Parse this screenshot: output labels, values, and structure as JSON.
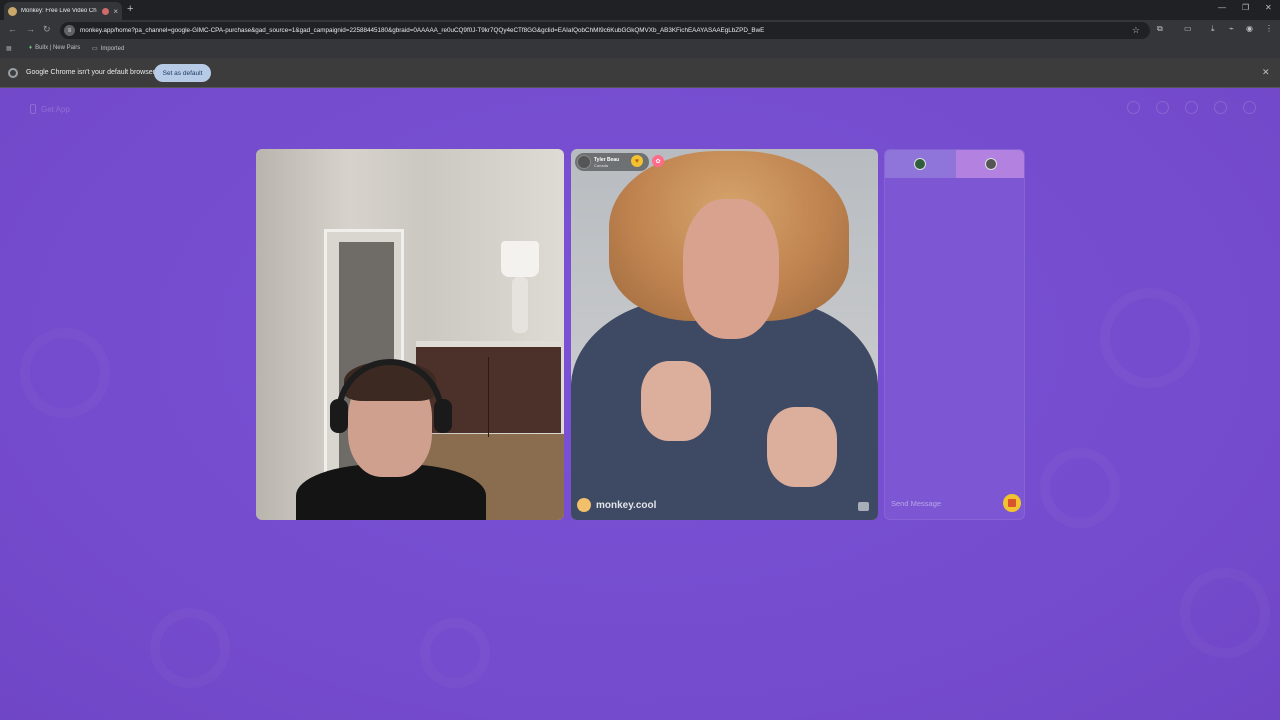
{
  "browser": {
    "tab_title": "Monkey: Free Live Video Ch",
    "url": "monkey.app/home?pa_channel=google-GIMC-CPA-purchase&gad_source=1&gad_campaignid=22588445180&gbraid=0AAAAA_re0uCQ9f0J-T9kr7QQy4eCTf8GG&gclid=EAIaIQobChMI9c6KubGGkQMVXb_AB3KFichEAAYASAAEgLbZPD_BwE",
    "bookmarks": [
      {
        "label": "Bullx | New Pairs",
        "icon": "bookmark-icon"
      },
      {
        "label": "Imported",
        "icon": "folder-icon"
      }
    ],
    "infobar": {
      "message": "Google Chrome isn't your default browser",
      "button": "Set as default"
    }
  },
  "app": {
    "get_app": "Get App",
    "top_icons": [
      "search-icon",
      "coin-icon",
      "history-icon",
      "chat-icon",
      "profile-icon"
    ],
    "remote_user": {
      "name": "Tyler Beau",
      "country": "Canada"
    },
    "watermark": "monkey.cool",
    "chat": {
      "placeholder": "Send Message"
    }
  },
  "colors": {
    "background": "#7a4fd0",
    "chat_tab_left": "#8f74d9",
    "chat_tab_right": "#b381e0",
    "gift_yellow": "#f2c230"
  }
}
